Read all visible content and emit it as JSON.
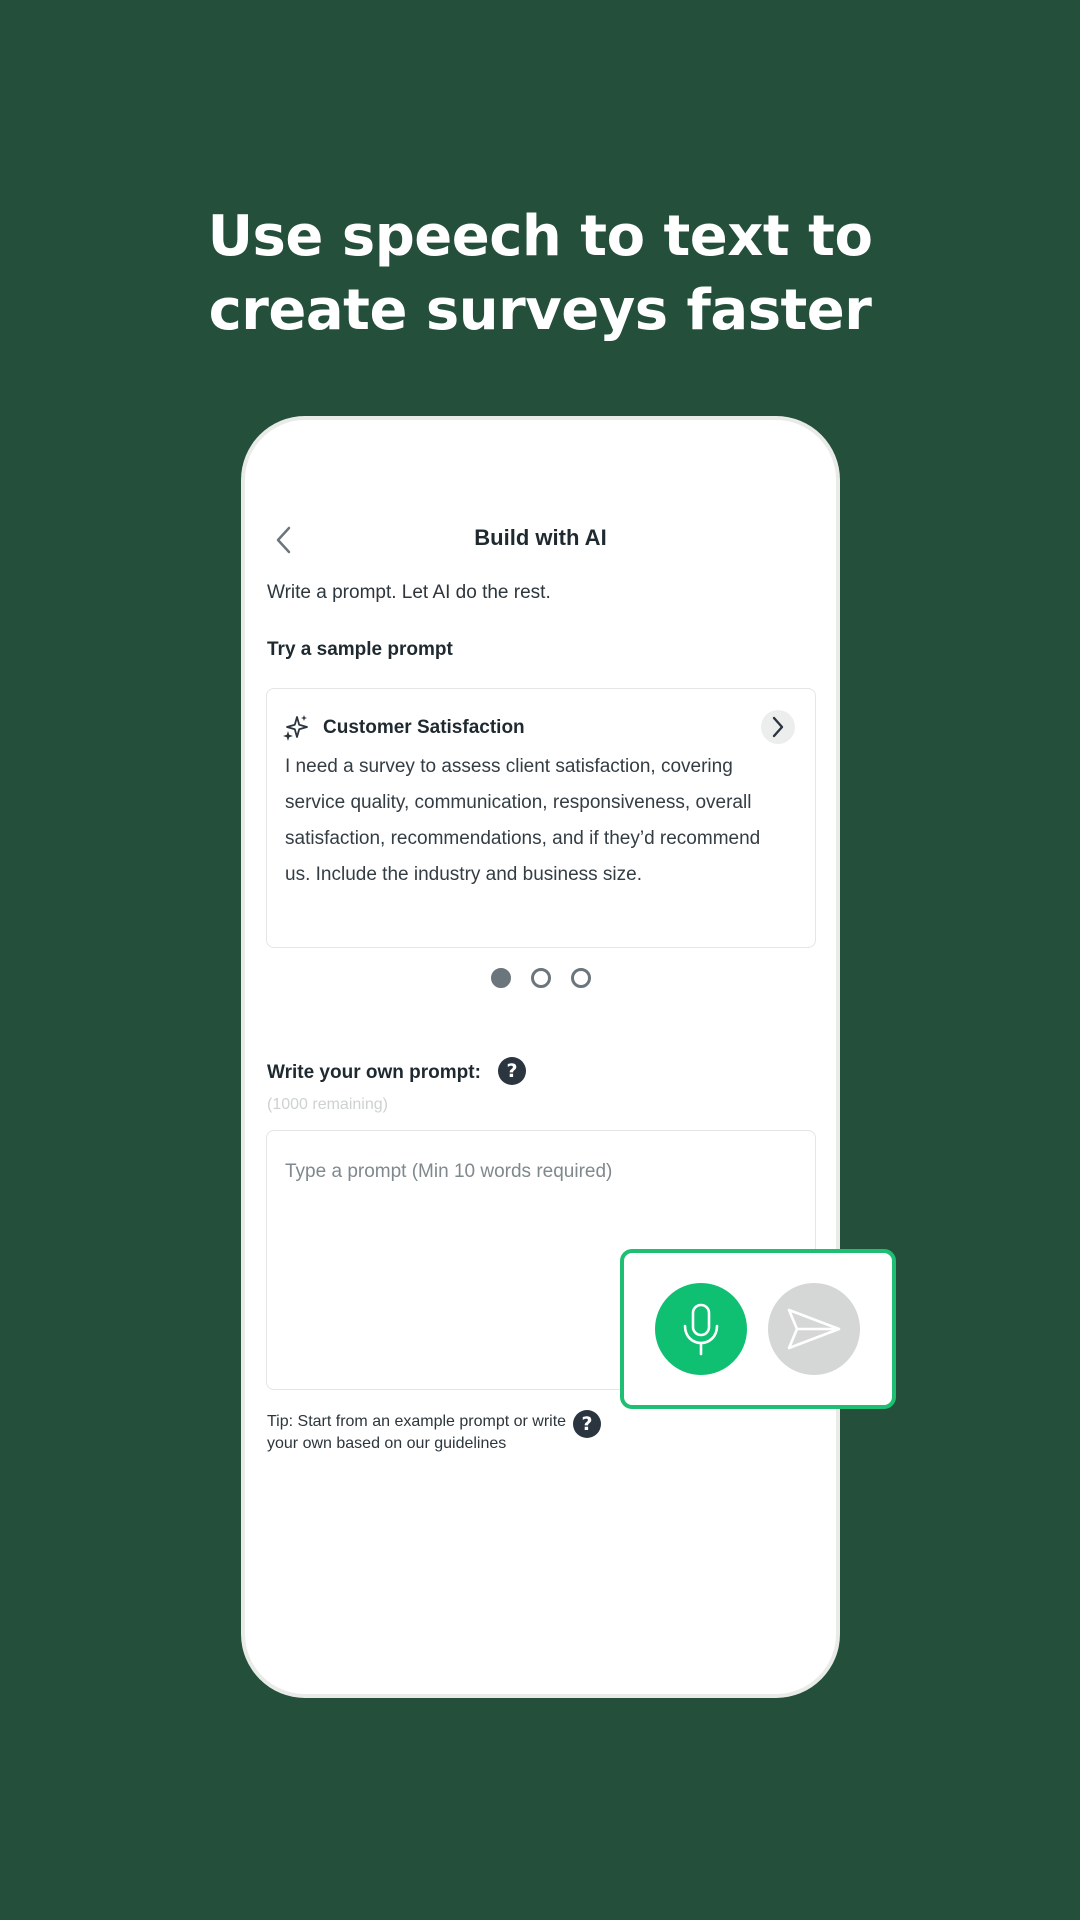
{
  "headline": {
    "line1": "Use speech to text to",
    "line2": "create surveys faster"
  },
  "screen": {
    "title": "Build with AI",
    "back_icon": "chevron-left-icon",
    "subtitle": "Write a prompt. Let AI do the rest.",
    "sample_label": "Try a sample prompt",
    "sample_card": {
      "icon": "sparkle-icon",
      "title": "Customer Satisfaction",
      "body": "I need a survey to assess client satisfaction, covering service quality, communication, responsiveness, overall satisfaction, recommendations, and if they’d recommend us. Include the industry and business size.",
      "next_icon": "chevron-right-icon"
    },
    "carousel": {
      "count": 3,
      "active": 1
    },
    "own_prompt_label": "Write your own prompt:",
    "remaining": "(1000 remaining)",
    "prompt_placeholder": "Type a prompt (Min 10 words required)",
    "tip": "Tip: Start from an example prompt or write your own based on our guidelines",
    "help_icon": "question-icon",
    "help_glyph": "?"
  },
  "actions": {
    "mic_icon": "microphone-icon",
    "send_icon": "send-icon"
  },
  "colors": {
    "background": "#234f3b",
    "accent": "#0fbf72",
    "disabled": "#d5d7d6"
  }
}
